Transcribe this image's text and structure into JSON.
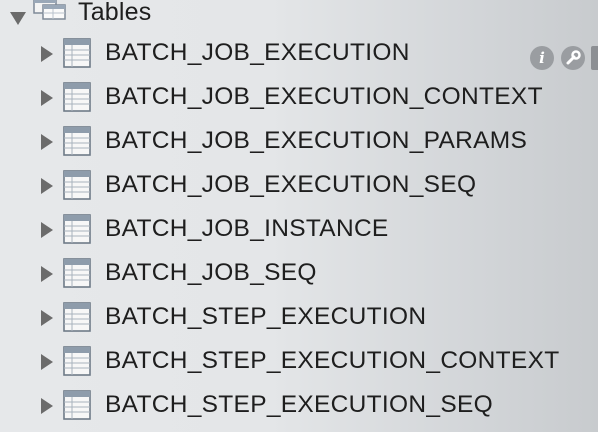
{
  "tree": {
    "group": {
      "label": "Tables",
      "icon": "tables-folder-icon",
      "expanded": true
    },
    "tables": [
      {
        "label": "BATCH_JOB_EXECUTION"
      },
      {
        "label": "BATCH_JOB_EXECUTION_CONTEXT"
      },
      {
        "label": "BATCH_JOB_EXECUTION_PARAMS"
      },
      {
        "label": "BATCH_JOB_EXECUTION_SEQ"
      },
      {
        "label": "BATCH_JOB_INSTANCE"
      },
      {
        "label": "BATCH_JOB_SEQ"
      },
      {
        "label": "BATCH_STEP_EXECUTION"
      },
      {
        "label": "BATCH_STEP_EXECUTION_CONTEXT"
      },
      {
        "label": "BATCH_STEP_EXECUTION_SEQ"
      }
    ],
    "row_actions": {
      "info_glyph": "i",
      "icons": [
        "info-icon",
        "settings-wrench-icon",
        "table-data-icon"
      ]
    }
  },
  "colors": {
    "text": "#1e1e1e",
    "disclosure": "#6b6b6b",
    "action_icon": "#9a9da1"
  }
}
